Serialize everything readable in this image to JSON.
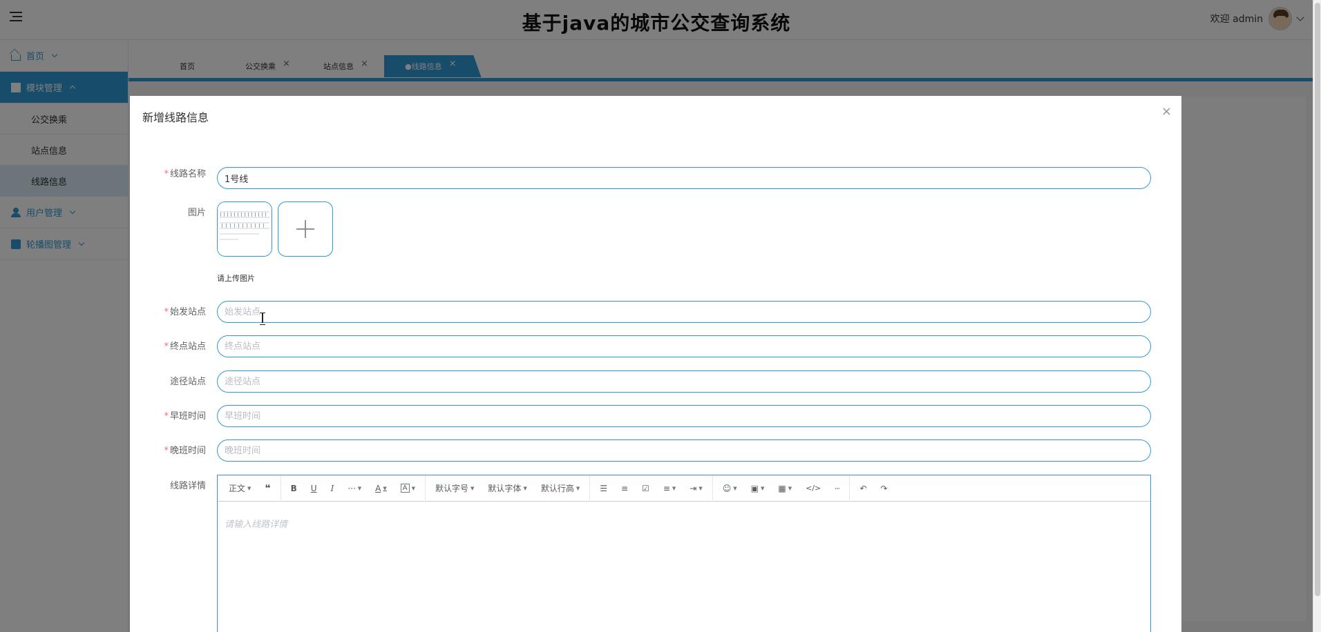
{
  "header": {
    "title": "基于java的城市公交查询系统",
    "user_greeting": "欢迎 admin"
  },
  "sidebar": {
    "items": [
      {
        "label": "首页",
        "icon": "home-icon"
      },
      {
        "label": "模块管理",
        "icon": "module-icon"
      },
      {
        "label": "用户管理",
        "icon": "user-icon"
      },
      {
        "label": "轮播图管理",
        "icon": "image-icon"
      }
    ],
    "sub_items": [
      "公交换乘",
      "站点信息",
      "线路信息"
    ]
  },
  "tabs": [
    {
      "label": "首页"
    },
    {
      "label": "公交换乘"
    },
    {
      "label": "站点信息"
    },
    {
      "label": "●线路信息"
    }
  ],
  "dialog": {
    "title": "新增线路信息",
    "close": "×",
    "fields": {
      "route_name": {
        "label": "线路名称",
        "value": "1号线"
      },
      "image": {
        "label": "图片",
        "tip": "请上传图片"
      },
      "start_station": {
        "label": "始发站点",
        "placeholder": "始发站点"
      },
      "end_station": {
        "label": "终点站点",
        "placeholder": "终点站点"
      },
      "via_stations": {
        "label": "途径站点",
        "placeholder": "途径站点"
      },
      "first_bus": {
        "label": "早班时间",
        "placeholder": "早班时间"
      },
      "last_bus": {
        "label": "晚班时间",
        "placeholder": "晚班时间"
      },
      "details": {
        "label": "线路详情",
        "placeholder": "请输入线路详情"
      }
    },
    "editor_toolbar": {
      "paragraph": "正文",
      "font_size": "默认字号",
      "font_family": "默认字体",
      "line_height": "默认行高"
    }
  },
  "colors": {
    "accent": "#2f98d4",
    "required": "#f56c6c"
  }
}
